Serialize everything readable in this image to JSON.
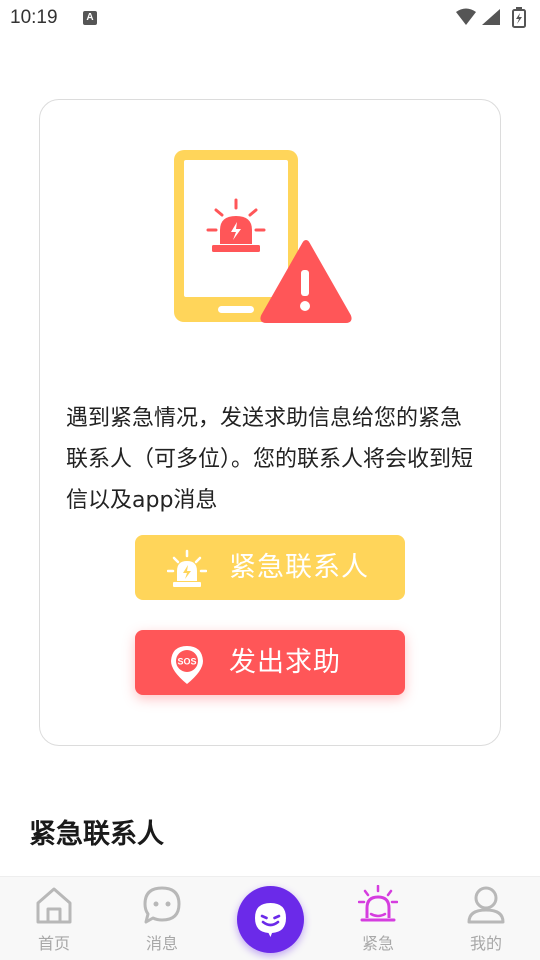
{
  "status_bar": {
    "time": "10:19",
    "notification_letter": "A"
  },
  "card": {
    "description": "遇到紧急情况，发送求助信息给您的紧急联系人（可多位）。您的联系人将会收到短信以及app消息",
    "contacts_button_label": "紧急联系人",
    "sos_button_label": "发出求助",
    "sos_badge": "SOS"
  },
  "section": {
    "title": "紧急联系人"
  },
  "tabbar": {
    "tabs": [
      {
        "label": "首页",
        "icon": "home-icon"
      },
      {
        "label": "消息",
        "icon": "message-icon"
      },
      {
        "label": "",
        "icon": "smile-center-icon"
      },
      {
        "label": "紧急",
        "icon": "alarm-icon",
        "active": true
      },
      {
        "label": "我的",
        "icon": "profile-icon"
      }
    ]
  },
  "colors": {
    "accent_yellow": "#ffd55a",
    "accent_red": "#ff5658",
    "accent_purple": "#6b2ae9",
    "active_tab": "#d53ddf"
  }
}
